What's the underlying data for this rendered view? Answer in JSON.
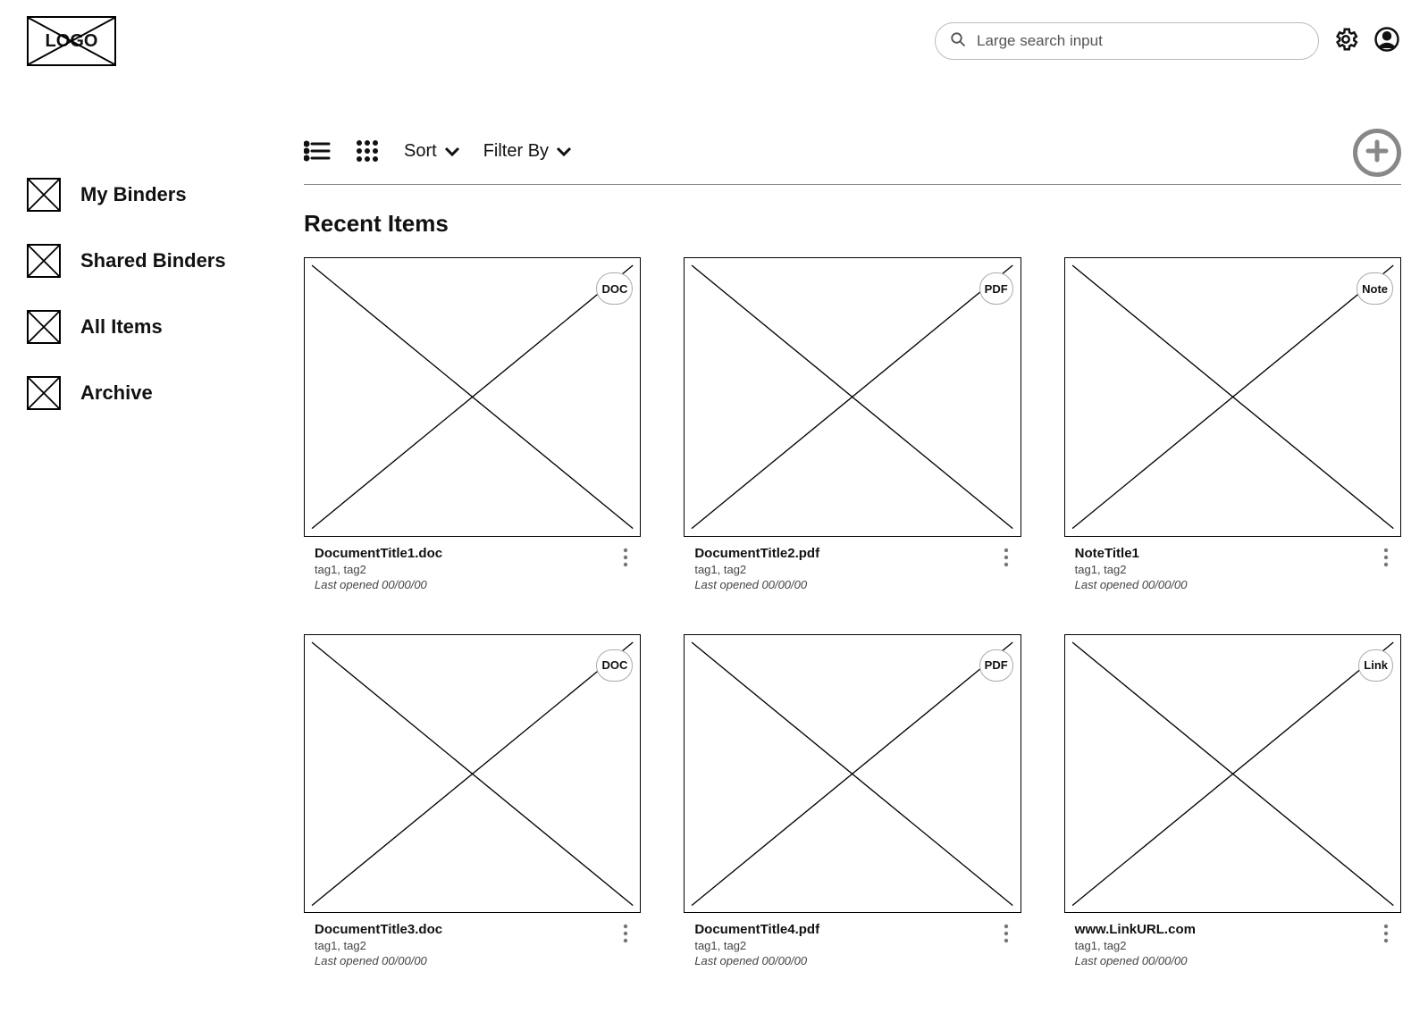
{
  "header": {
    "logo_text": "LOGO",
    "search_placeholder": "Large search input"
  },
  "sidebar": {
    "items": [
      {
        "label": "My Binders"
      },
      {
        "label": "Shared Binders"
      },
      {
        "label": "All Items"
      },
      {
        "label": "Archive"
      }
    ]
  },
  "toolbar": {
    "sort_label": "Sort",
    "filter_label": "Filter By"
  },
  "section_title": "Recent Items",
  "items": [
    {
      "badge": "DOC",
      "title": "DocumentTitle1.doc",
      "tags": "tag1, tag2",
      "last_opened": "Last opened 00/00/00"
    },
    {
      "badge": "PDF",
      "title": "DocumentTitle2.pdf",
      "tags": "tag1, tag2",
      "last_opened": "Last opened 00/00/00"
    },
    {
      "badge": "Note",
      "title": "NoteTitle1",
      "tags": "tag1, tag2",
      "last_opened": "Last opened 00/00/00"
    },
    {
      "badge": "DOC",
      "title": "DocumentTitle3.doc",
      "tags": "tag1, tag2",
      "last_opened": "Last opened 00/00/00"
    },
    {
      "badge": "PDF",
      "title": "DocumentTitle4.pdf",
      "tags": "tag1, tag2",
      "last_opened": "Last opened 00/00/00"
    },
    {
      "badge": "Link",
      "title": "www.LinkURL.com",
      "tags": "tag1, tag2",
      "last_opened": "Last opened 00/00/00"
    }
  ]
}
